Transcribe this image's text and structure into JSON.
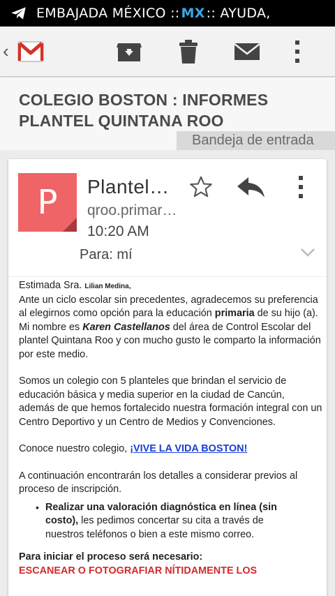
{
  "status_bar": {
    "pre": "EMBAJADA MÉXICO ::",
    "mx": "MX",
    "post": ":: AYUDA,"
  },
  "toolbar": {
    "back": "‹",
    "icons": [
      "gmail-logo",
      "archive-icon",
      "trash-icon",
      "mark-unread-icon",
      "overflow-menu-icon"
    ]
  },
  "email": {
    "subject": "COLEGIO BOSTON : INFORMES PLANTEL QUINTANA ROO",
    "label": "Bandeja de entrada",
    "avatar_letter": "P",
    "sender": "Plantel…",
    "address": "qroo.primar…",
    "time": "10:20 AM",
    "recipients": "Para: mí"
  },
  "body": {
    "greeting": "Estimada Sra.",
    "greeting_name": "Lilian Medina,",
    "p1_a": "Ante un ciclo escolar sin precedentes, agradecemos su preferencia al elegirnos como opción para la educación",
    "p1_bold": "primaria",
    "p1_b": "de su hijo (a).",
    "p2_a": "Mi nombre es",
    "p2_name": "Karen Castellanos",
    "p2_b": "del área de Control Escolar del plantel Quintana Roo y con mucho gusto le comparto la información por este medio.",
    "p3": "Somos un colegio con 5 planteles que brindan el servicio de educación básica y media superior en la ciudad de Cancún, además de que hemos fortalecido nuestra formación integral con un Centro Deportivo y un Centro de Medios y Convenciones.",
    "p4_a": "Conoce nuestro colegio,",
    "p4_link": "¡VIVE LA VIDA BOSTON!",
    "p5": "A continuación encontrarán los detalles a considerar previos al  proceso de inscripción.",
    "bullet_bold": "Realizar una valoración diagnóstica en línea (sin costo),",
    "bullet_rest": "les pedimos concertar su cita a través de nuestros teléfonos o bien a este mismo correo.",
    "p6": "Para iniciar el proceso será necesario:",
    "p7_cut": "ESCANEAR O FOTOGRAFIAR NÍTIDAMENTE LOS"
  },
  "colors": {
    "avatar": "#ef6467",
    "link": "#1a3fd4",
    "accent_red": "#d42a2a",
    "mx_blue": "#3aa7e0"
  }
}
